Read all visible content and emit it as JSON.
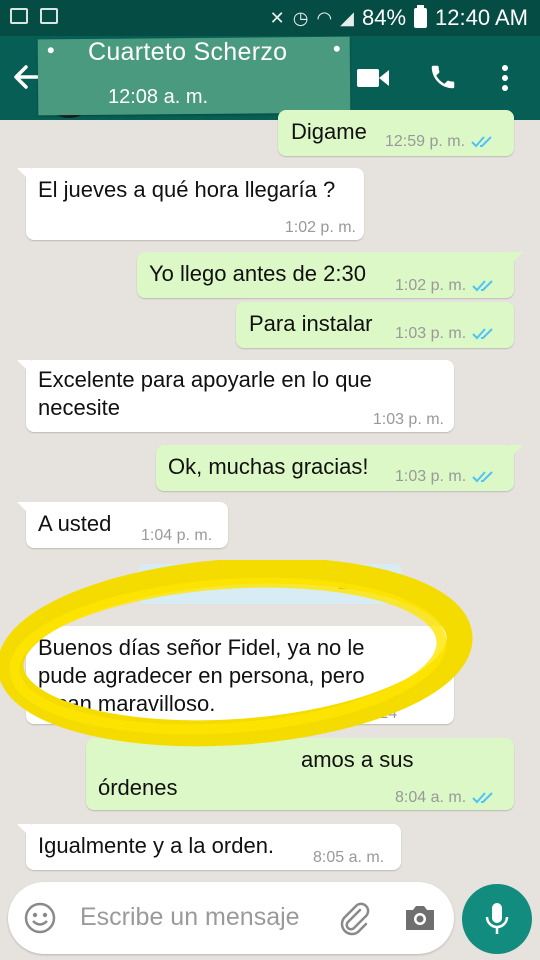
{
  "status_bar": {
    "battery_percent": "84%",
    "time": "12:40 AM"
  },
  "header": {
    "title": "Cuarteto Scherzo",
    "subtitle": "12:08 a. m."
  },
  "messages": [
    {
      "dir": "out",
      "text": "Digame",
      "time": "12:59 p. m.",
      "read": true
    },
    {
      "dir": "in",
      "text": "El jueves a qué hora llegaría ?",
      "time": "1:02 p. m."
    },
    {
      "dir": "out",
      "text": "Yo llego antes de 2:30",
      "time": "1:02 p. m.",
      "read": true
    },
    {
      "dir": "out",
      "text": "Para instalar",
      "time": "1:03 p. m.",
      "read": true
    },
    {
      "dir": "in",
      "lines": [
        "Excelente para apoyarle en lo que",
        "necesite"
      ],
      "time": "1:03 p. m."
    },
    {
      "dir": "out",
      "text": "Ok, muchas gracias!",
      "time": "1:03 p. m.",
      "read": true
    },
    {
      "dir": "in",
      "text": "A usted",
      "time": "1:04 p. m."
    },
    {
      "dir": "in",
      "lines": [
        "Buenos días señor Fidel, ya no le",
        "pude agradecer en persona, pero",
        "tocan maravilloso."
      ],
      "time": "6:24"
    },
    {
      "dir": "out",
      "lines": [
        "amos a sus",
        "órdenes"
      ],
      "time": "8:04 a. m.",
      "read": true
    },
    {
      "dir": "in",
      "text": "Igualmente y a la orden.",
      "time": "8:05 a. m."
    }
  ],
  "date_chip": "2018",
  "composer": {
    "placeholder": "Escribe un mensaje"
  },
  "colors": {
    "header": "#075e54",
    "status_bar": "#054d44",
    "outgoing_bubble": "#dcf8c6",
    "incoming_bubble": "#ffffff",
    "accent": "#128c7e",
    "read_ticks": "#4fc3f7",
    "highlight": "#f5dc00"
  },
  "icons": [
    "back-arrow-icon",
    "video-call-icon",
    "phone-icon",
    "more-vert-icon",
    "emoji-icon",
    "attach-icon",
    "camera-icon",
    "mic-icon",
    "double-check-icon"
  ]
}
